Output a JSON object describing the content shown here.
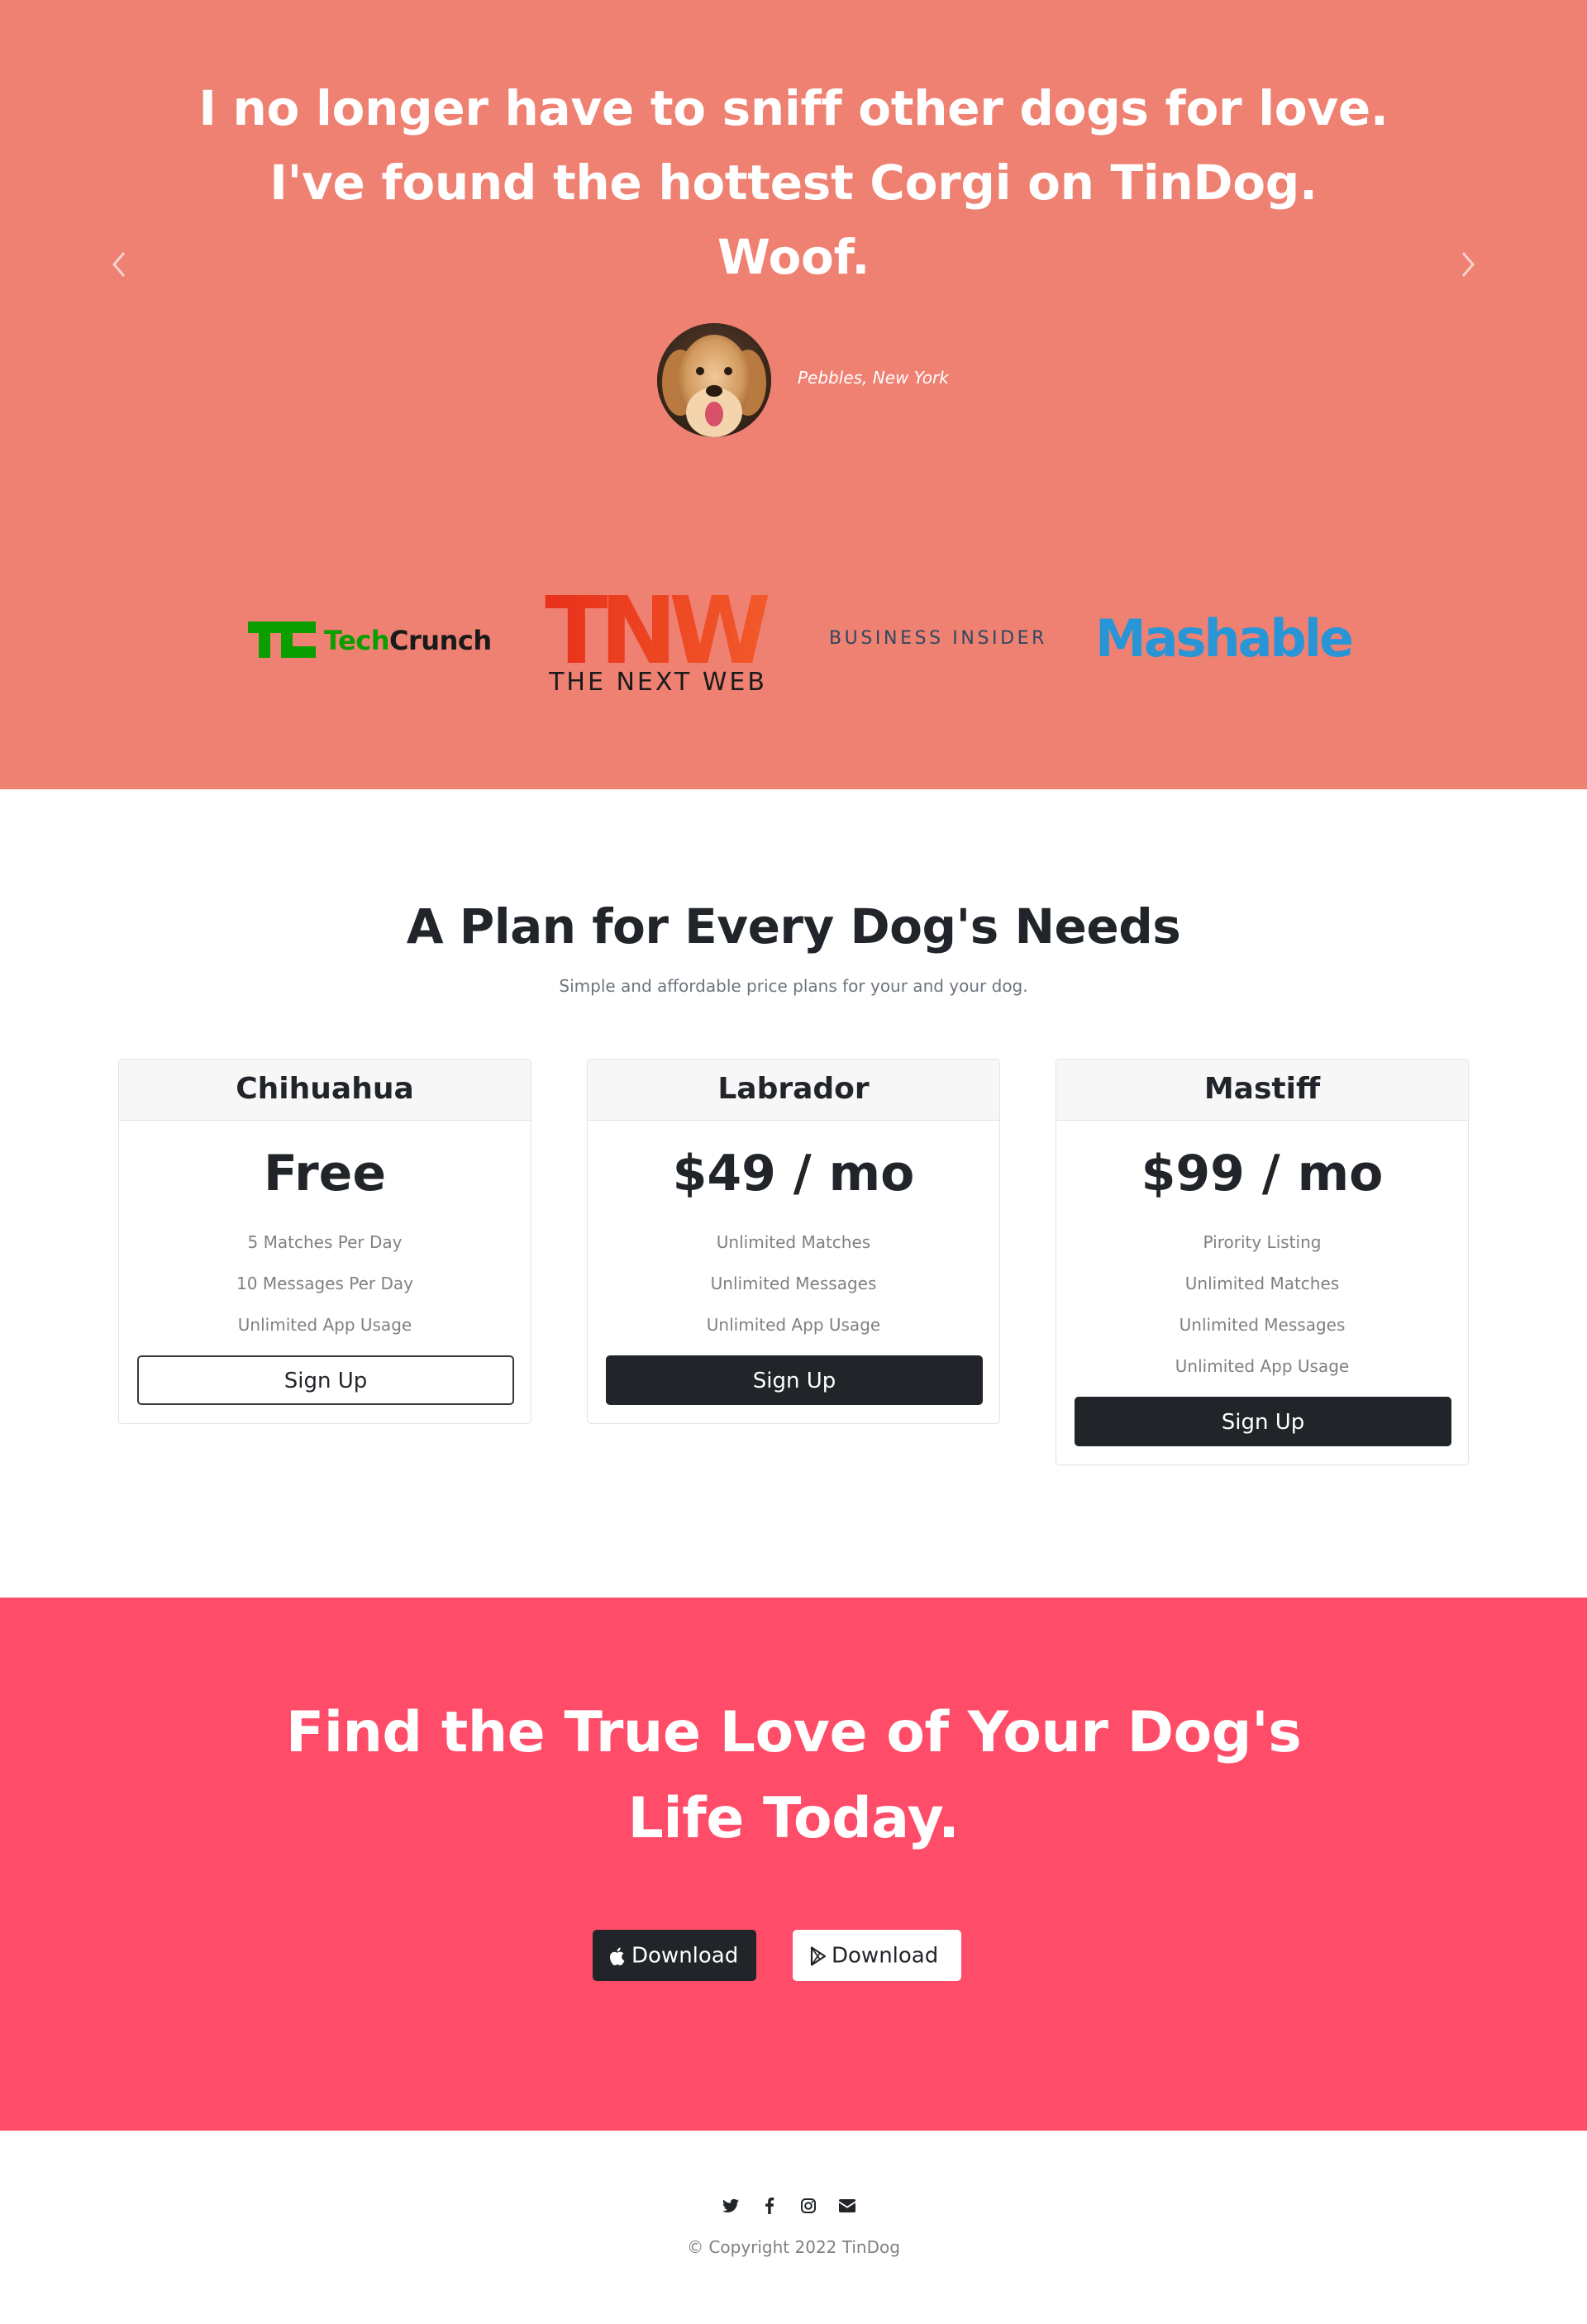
{
  "testimonial": {
    "quote_lines": [
      "I no longer have to sniff other dogs for love.",
      "I've found the hottest Corgi on TinDog.",
      "Woof."
    ],
    "reviewer": "Pebbles, New York",
    "prev_icon": "chevron-left-icon",
    "next_icon": "chevron-right-icon"
  },
  "press": {
    "techcrunch": {
      "tech": "Tech",
      "crunch": "Crunch"
    },
    "tnw": {
      "mark": "TNW",
      "subtitle": "THE NEXT WEB"
    },
    "business_insider": "BUSINESS INSIDER",
    "mashable": "Mashable"
  },
  "pricing": {
    "title": "A Plan for Every Dog's Needs",
    "subtitle": "Simple and affordable price plans for your and your dog.",
    "plans": [
      {
        "name": "Chihuahua",
        "price": "Free",
        "features": [
          "5 Matches Per Day",
          "10 Messages Per Day",
          "Unlimited App Usage"
        ],
        "button": "Sign Up"
      },
      {
        "name": "Labrador",
        "price": "$49 / mo",
        "features": [
          "Unlimited Matches",
          "Unlimited Messages",
          "Unlimited App Usage"
        ],
        "button": "Sign Up"
      },
      {
        "name": "Mastiff",
        "price": "$99 / mo",
        "features": [
          "Pirority Listing",
          "Unlimited Matches",
          "Unlimited Messages",
          "Unlimited App Usage"
        ],
        "button": "Sign Up"
      }
    ]
  },
  "cta": {
    "title_lines": [
      "Find the True Love of Your Dog's",
      "Life Today."
    ],
    "apple_button": "Download",
    "play_button": "Download"
  },
  "footer": {
    "social_icons": [
      "twitter-icon",
      "facebook-icon",
      "instagram-icon",
      "envelope-icon"
    ],
    "copyright": "© Copyright 2022 TinDog"
  },
  "colors": {
    "testimonial_bg": "#ef8172",
    "cta_bg": "#ff4c68",
    "dark": "#212529",
    "techcrunch_green": "#0a9e01",
    "tnw_red": "#f2401c",
    "business_insider_blue": "#2d4860",
    "mashable_blue": "#2895d6"
  }
}
